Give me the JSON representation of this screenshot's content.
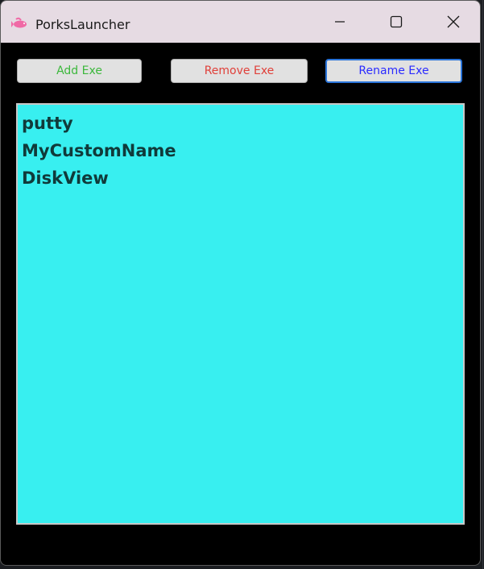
{
  "window": {
    "title": "PorksLauncher"
  },
  "colors": {
    "titlebar": "#e6dbe3",
    "background": "#000000",
    "list_background": "#38eff0",
    "add_text": "#3cb83c",
    "remove_text": "#e0403a",
    "rename_text": "#2b2bff",
    "focus_border": "#2a74d9"
  },
  "titlebar": {
    "icon": "app-pink-fish-icon",
    "minimize_icon": "minimize-icon",
    "maximize_icon": "maximize-icon",
    "close_icon": "close-icon"
  },
  "toolbar": {
    "add_label": "Add Exe",
    "remove_label": "Remove Exe",
    "rename_label": "Rename Exe"
  },
  "list": {
    "items": [
      "putty",
      "MyCustomName",
      "DiskView"
    ]
  }
}
